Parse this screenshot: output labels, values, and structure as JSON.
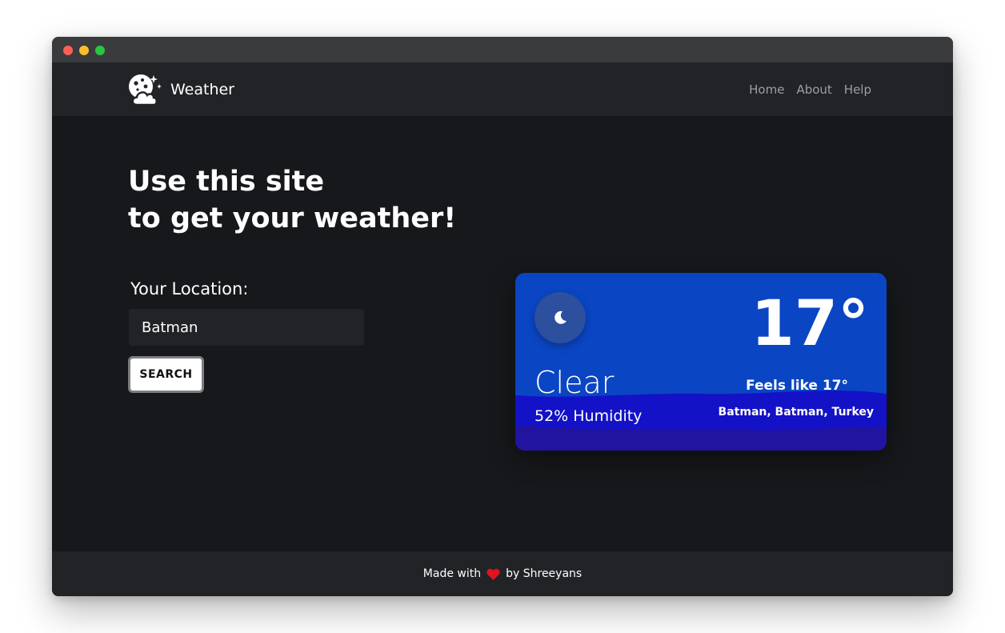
{
  "nav": {
    "brand": "Weather",
    "links": [
      "Home",
      "About",
      "Help"
    ]
  },
  "hero": {
    "line1": "Use this site",
    "line2": "to get your weather!"
  },
  "form": {
    "label": "Your Location:",
    "input_value": "Batman",
    "button": "SEARCH"
  },
  "card": {
    "icon": "moon-icon",
    "temperature": "17°",
    "condition": "Clear",
    "humidity": "52% Humidity",
    "feels_like": "Feels like 17°",
    "location": "Batman, Batman, Turkey"
  },
  "footer": {
    "made_with": "Made with",
    "heart_icon": "heart-icon",
    "by": "by Shreeyans"
  },
  "colors": {
    "card_bg": "#0a45c4",
    "page_bg": "#16181b",
    "navbar_bg": "#212327",
    "heart": "#e0141e"
  }
}
